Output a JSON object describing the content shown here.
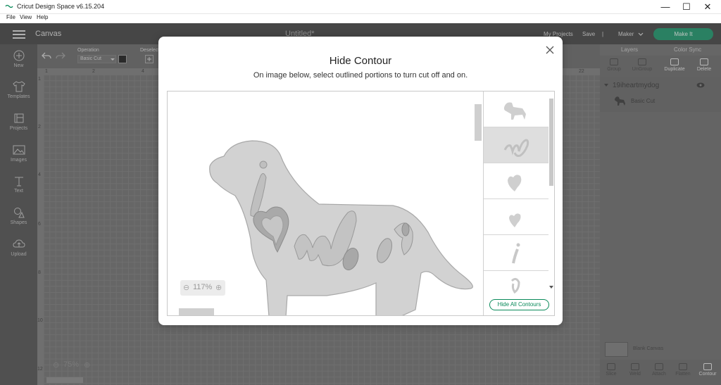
{
  "window": {
    "title": "Cricut Design Space  v6.15.204",
    "minimize": "—",
    "maximize": "☐",
    "close": "✕"
  },
  "menu": [
    "File",
    "View",
    "Help"
  ],
  "header": {
    "canvas_label": "Canvas",
    "project_title": "Untitled*",
    "my_projects": "My Projects",
    "save": "Save",
    "separator": "|",
    "machine": "Maker",
    "make_it": "Make It"
  },
  "left_toolbar": [
    {
      "label": "New",
      "icon": "plus-circle-icon"
    },
    {
      "label": "Templates",
      "icon": "tshirt-icon"
    },
    {
      "label": "Projects",
      "icon": "projects-icon"
    },
    {
      "label": "Images",
      "icon": "image-icon"
    },
    {
      "label": "Text",
      "icon": "text-icon"
    },
    {
      "label": "Shapes",
      "icon": "shapes-icon"
    },
    {
      "label": "Upload",
      "icon": "upload-cloud-icon"
    }
  ],
  "edit_toolbar": {
    "operation_label": "Operation",
    "operation_value": "Basic Cut",
    "deselect_label": "Deselect",
    "operation_color": "#000000"
  },
  "rulers": {
    "top": [
      "1",
      "2",
      "4",
      "22"
    ],
    "left": [
      "1",
      "2",
      "4",
      "6",
      "8",
      "10",
      "12"
    ]
  },
  "canvas_zoom": "75%",
  "right_panel": {
    "tabs": [
      "Layers",
      "Color Sync"
    ],
    "tools": [
      {
        "label": "Group",
        "enabled": false
      },
      {
        "label": "UnGroup",
        "enabled": false
      },
      {
        "label": "Duplicate",
        "enabled": true
      },
      {
        "label": "Delete",
        "enabled": true
      }
    ],
    "layer_name": "19iheartmydog",
    "layer_sub": "Basic Cut",
    "blank_canvas": "Blank Canvas",
    "bottom_tools": [
      "Slice",
      "Weld",
      "Attach",
      "Flatten",
      "Contour"
    ]
  },
  "modal": {
    "title": "Hide Contour",
    "subtitle": "On image below, select outlined portions to turn cut off and on.",
    "zoom": "117%",
    "hide_all_button": "Hide All Contours",
    "close_icon": "close-icon",
    "thumbnails": [
      {
        "kind": "dog",
        "selected": false
      },
      {
        "kind": "my",
        "selected": true
      },
      {
        "kind": "heart",
        "selected": false
      },
      {
        "kind": "heart",
        "selected": false
      },
      {
        "kind": "i",
        "selected": false
      },
      {
        "kind": "g",
        "selected": false
      }
    ]
  }
}
